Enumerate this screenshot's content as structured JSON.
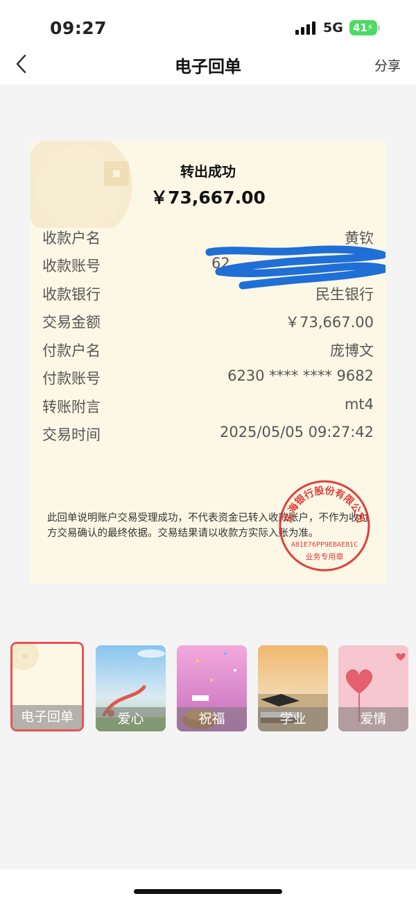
{
  "status_bar": {
    "time": "09:27",
    "network": "5G",
    "battery": "41"
  },
  "nav": {
    "title": "电子回单",
    "share_label": "分享"
  },
  "receipt": {
    "title": "转出成功",
    "amount": "￥73,667.00",
    "rows": [
      {
        "label": "收款户名",
        "value": "黄钦"
      },
      {
        "label": "收款账号",
        "value": "62"
      },
      {
        "label": "收款银行",
        "value": "民生银行"
      },
      {
        "label": "交易金额",
        "value": "￥73,667.00"
      },
      {
        "label": "付款户名",
        "value": "庞博文"
      },
      {
        "label": "付款账号",
        "value": "6230 **** **** 9682"
      },
      {
        "label": "转账附言",
        "value": "mt4"
      },
      {
        "label": "交易时间",
        "value": "2025/05/05 09:27:42"
      }
    ],
    "disclaimer": "此回单说明账户交易受理成功，不代表资金已转入收款账户，不作为收付方交易确认的最终依据。交易结果请以收款方实际入账为准。",
    "stamp": {
      "top_text": "东海银行股份有限公司",
      "code": "A81E76PP9EBAE81C",
      "bottom_text": "业务专用章"
    }
  },
  "templates": [
    {
      "label": "电子回单",
      "selected": true
    },
    {
      "label": "爱心",
      "selected": false
    },
    {
      "label": "祝福",
      "selected": false
    },
    {
      "label": "学业",
      "selected": false
    },
    {
      "label": "爱情",
      "selected": false
    }
  ],
  "colors": {
    "receipt_bg": "#fdf8e6",
    "stamp_red": "#e02828",
    "selected_border": "#e85454",
    "scribble_blue": "#1f6fd6"
  }
}
